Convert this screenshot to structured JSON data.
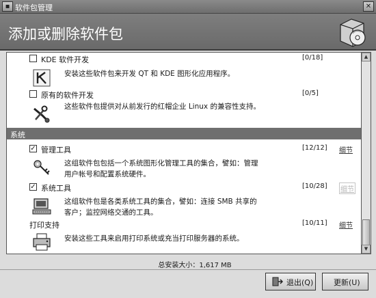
{
  "window": {
    "title": "软件包管理"
  },
  "header": {
    "title": "添加或删除软件包",
    "icon": "package-cd-icon"
  },
  "packages_top": [
    {
      "name": "KDE 软件开发",
      "checked": false,
      "count": "[0/18]",
      "description": "安装这些软件包来开发 QT 和 KDE 图形化应用程序。",
      "icon": "kde-development-icon"
    },
    {
      "name": "原有的软件开发",
      "checked": false,
      "count": "[0/5]",
      "description": "这些软件包提供对从前发行的红帽企业 Linux 的兼容性支持。",
      "icon": "legacy-tools-icon"
    }
  ],
  "section": {
    "label": "系统"
  },
  "packages_system": [
    {
      "name": "管理工具",
      "checked": true,
      "count": "[12/12]",
      "detail_label": "细节",
      "detail_enabled": true,
      "description_lines": [
        "这组软件包包括一个系统图形化管理工具的集合，譬如：管理",
        "用户帐号和配置系统硬件。"
      ],
      "icon": "keys-icon"
    },
    {
      "name": "系统工具",
      "checked": true,
      "count": "[10/28]",
      "detail_label": "细节",
      "detail_enabled": false,
      "description_lines": [
        "这组软件包是各类系统工具的集合，譬如：连接 SMB 共享的",
        "客户；监控网络交通的工具。"
      ],
      "icon": "computer-icon"
    },
    {
      "name": "打印支持",
      "checked": null,
      "count": "[10/11]",
      "detail_label": "细节",
      "detail_enabled": true,
      "description_lines": [
        "安装这些工具来启用打印系统或充当打印服务器的系统。"
      ],
      "icon": "printer-icon"
    }
  ],
  "footer": {
    "total_label": "总安装大小：",
    "total_value": "1,617 MB",
    "quit_label": "退出(Q)",
    "update_label": "更新(U)"
  }
}
